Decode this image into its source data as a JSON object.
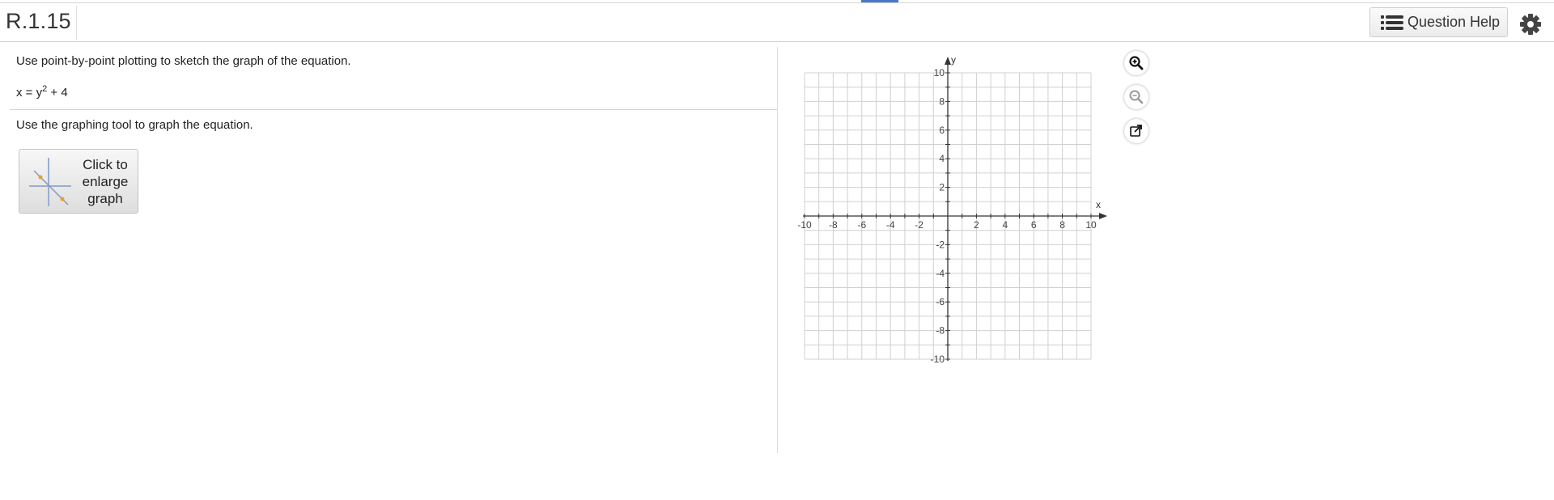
{
  "header": {
    "question_id": "R.1.15",
    "help_label": "Question Help",
    "help_icon": "list-icon",
    "settings_icon": "gear-icon"
  },
  "question": {
    "instruction": "Use point-by-point plotting to sketch the graph of the equation.",
    "equation_base": "x = y",
    "equation_exp": "2",
    "equation_tail": " + 4",
    "graph_instruction": "Use the graphing tool to graph the equation.",
    "enlarge_label": "Click to\nenlarge\ngraph"
  },
  "graph": {
    "x_label": "x",
    "y_label": "y",
    "x_min": -10,
    "x_max": 10,
    "y_min": -10,
    "y_max": 10,
    "grid_step": 1,
    "label_step": 2,
    "tools": [
      "zoom-in-icon",
      "zoom-out-icon",
      "popout-icon"
    ]
  },
  "colors": {
    "accent": "#4a78c8",
    "grid": "#d0d0d0",
    "axis": "#333333",
    "tool_active": "#111111",
    "tool_inactive": "#9a9a9a"
  }
}
